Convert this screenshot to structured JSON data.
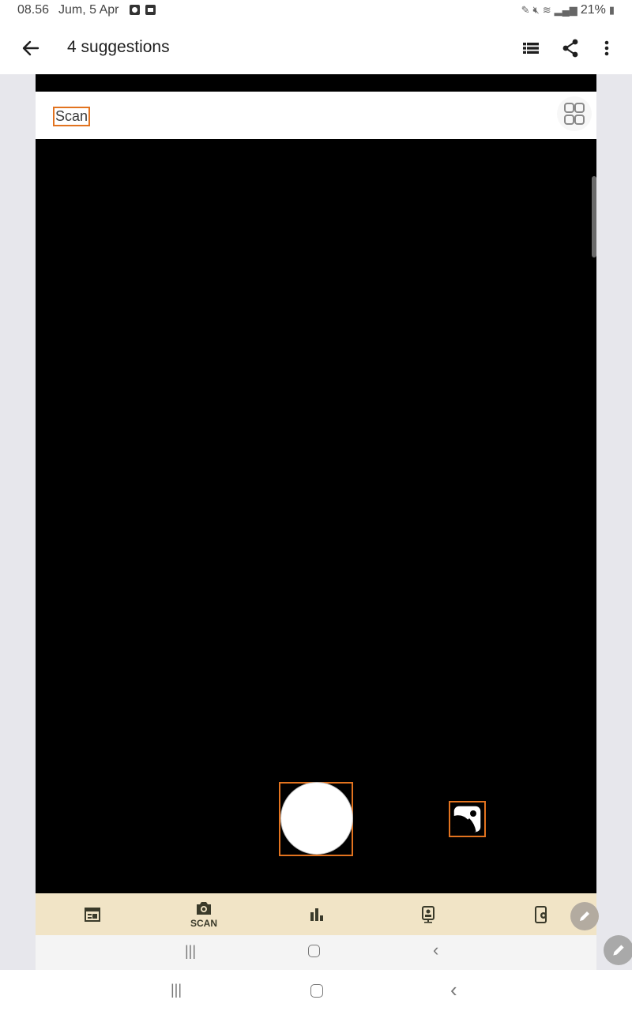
{
  "status_bar": {
    "time": "08.56",
    "date": "Jum, 5 Apr",
    "battery": "21%"
  },
  "app_bar": {
    "title": "4 suggestions",
    "icons": [
      "back-arrow-icon",
      "list-view-icon",
      "share-icon",
      "more-vert-icon"
    ]
  },
  "scan_page": {
    "header_label": "Scan",
    "view_toggle_icon": "grid-icon"
  },
  "camera": {
    "shutter_icon": "shutter-circle",
    "gallery_icon": "gallery-icon"
  },
  "bottom_nav": {
    "items": [
      {
        "icon": "card-icon",
        "label": ""
      },
      {
        "icon": "camera-icon",
        "label": "SCAN"
      },
      {
        "icon": "bar-chart-icon",
        "label": ""
      },
      {
        "icon": "product-icon",
        "label": ""
      },
      {
        "icon": "device-settings-icon",
        "label": ""
      }
    ]
  },
  "colors": {
    "accent_orange": "#e2731f",
    "nav_background": "#f1e4c6",
    "camera_background": "#000000"
  }
}
